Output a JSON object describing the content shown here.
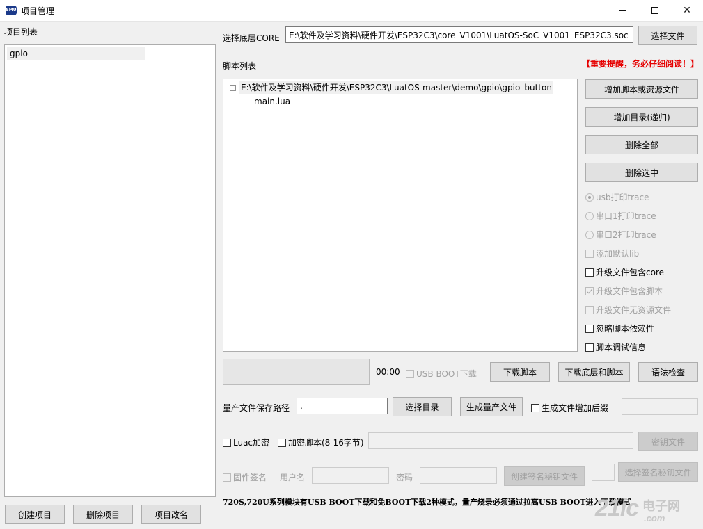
{
  "window": {
    "title": "项目管理",
    "icon_text": "SMU",
    "controls": {
      "minimize": "minimize-icon",
      "maximize": "maximize-icon",
      "close": "✕"
    }
  },
  "project_list": {
    "label": "项目列表",
    "items": [
      {
        "label": "gpio",
        "selected": true
      }
    ]
  },
  "project_buttons": {
    "create": "创建项目",
    "delete": "删除项目",
    "rename": "项目改名"
  },
  "core": {
    "label": "选择底层CORE",
    "path": "E:\\软件及学习资料\\硬件开发\\ESP32C3\\core_V1001\\LuatOS-SoC_V1001_ESP32C3.soc",
    "select_button": "选择文件"
  },
  "script_list": {
    "label": "脚本列表",
    "warning": "【重要提醒，务必仔细阅读！】",
    "tree": {
      "root": "E:\\软件及学习资料\\硬件开发\\ESP32C3\\LuatOS-master\\demo\\gpio\\gpio_button",
      "children": [
        "main.lua"
      ]
    }
  },
  "script_buttons": {
    "add_file": "增加脚本或资源文件",
    "add_dir": "增加目录(递归)",
    "delete_all": "删除全部",
    "delete_selected": "删除选中"
  },
  "options": {
    "usb_trace": {
      "label": "usb打印trace",
      "checked": true,
      "enabled": false
    },
    "uart1_trace": {
      "label": "串口1打印trace",
      "checked": false,
      "enabled": false
    },
    "uart2_trace": {
      "label": "串口2打印trace",
      "checked": false,
      "enabled": false
    },
    "add_default_lib": {
      "label": "添加默认lib",
      "checked": false,
      "enabled": false
    },
    "include_core": {
      "label": "升级文件包含core",
      "checked": false,
      "enabled": true
    },
    "include_script": {
      "label": "升级文件包含脚本",
      "checked": true,
      "enabled": false
    },
    "no_resource": {
      "label": "升级文件无资源文件",
      "checked": false,
      "enabled": false
    },
    "ignore_deps": {
      "label": "忽略脚本依赖性",
      "checked": false,
      "enabled": true
    },
    "debug_info": {
      "label": "脚本调试信息",
      "checked": false,
      "enabled": true
    }
  },
  "download": {
    "timer": "00:00",
    "usb_boot": {
      "label": "USB BOOT下载",
      "checked": false,
      "enabled": false
    },
    "download_script": "下载脚本",
    "download_core_script": "下载底层和脚本",
    "syntax_check": "语法检查"
  },
  "mass_production": {
    "label": "量产文件保存路径",
    "path": ".",
    "select_dir": "选择目录",
    "generate": "生成量产文件",
    "suffix": {
      "label": "生成文件增加后缀",
      "checked": false,
      "enabled": true
    }
  },
  "encryption": {
    "luac": {
      "label": "Luac加密",
      "checked": false
    },
    "encrypt_script": {
      "label": "加密脚本(8-16字节)",
      "checked": false
    },
    "key_file": "密钥文件"
  },
  "signing": {
    "firmware_sign": {
      "label": "固件签名",
      "checked": false
    },
    "username_label": "用户名",
    "password_label": "密码",
    "create_key": "创建签名秘钥文件",
    "select_key": "选择签名秘钥文件"
  },
  "note": "720S,720U系列模块有USB BOOT下载和免BOOT下载2种模式，量产烧录必须通过拉高USB BOOT进入下载模式",
  "watermark": {
    "main": "21ic",
    "cn": "电子网",
    "sub": ".com"
  },
  "colors": {
    "warning": "#e60000",
    "disabled_text": "#a0a0a0",
    "selected_item": "#f0f0f0"
  }
}
